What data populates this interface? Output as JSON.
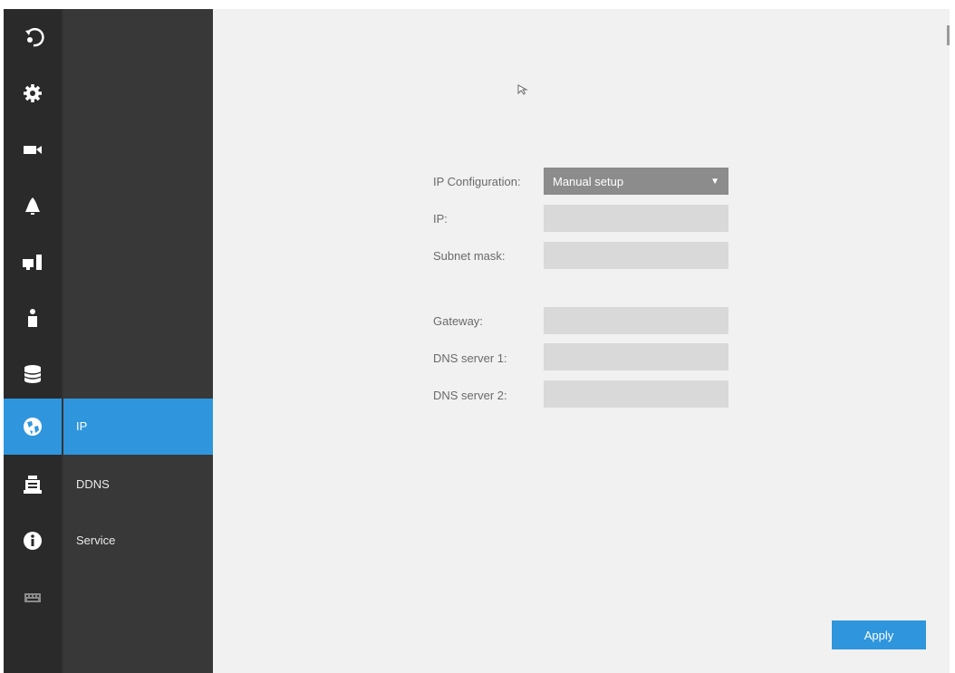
{
  "sidebar": {
    "icons": [
      {
        "name": "logout-icon"
      },
      {
        "name": "gear-icon"
      },
      {
        "name": "camera-icon"
      },
      {
        "name": "alarm-bell-icon"
      },
      {
        "name": "device-icon"
      },
      {
        "name": "user-icon"
      },
      {
        "name": "storage-icon"
      },
      {
        "name": "network-globe-icon"
      },
      {
        "name": "calendar-icon"
      },
      {
        "name": "info-icon"
      },
      {
        "name": "keyboard-icon"
      }
    ],
    "active_index": 7,
    "active_color": "#2f96dd"
  },
  "submenu": {
    "items": [
      {
        "label": "IP"
      },
      {
        "label": "DDNS"
      },
      {
        "label": "Service"
      }
    ],
    "active_index": 0
  },
  "form": {
    "ip_configuration": {
      "label": "IP Configuration:",
      "value": "Manual setup"
    },
    "ip": {
      "label": "IP:",
      "value": ""
    },
    "subnet_mask": {
      "label": "Subnet mask:",
      "value": ""
    },
    "gateway": {
      "label": "Gateway:",
      "value": ""
    },
    "dns1": {
      "label": "DNS server 1:",
      "value": ""
    },
    "dns2": {
      "label": "DNS server 2:",
      "value": ""
    }
  },
  "apply_label": "Apply"
}
